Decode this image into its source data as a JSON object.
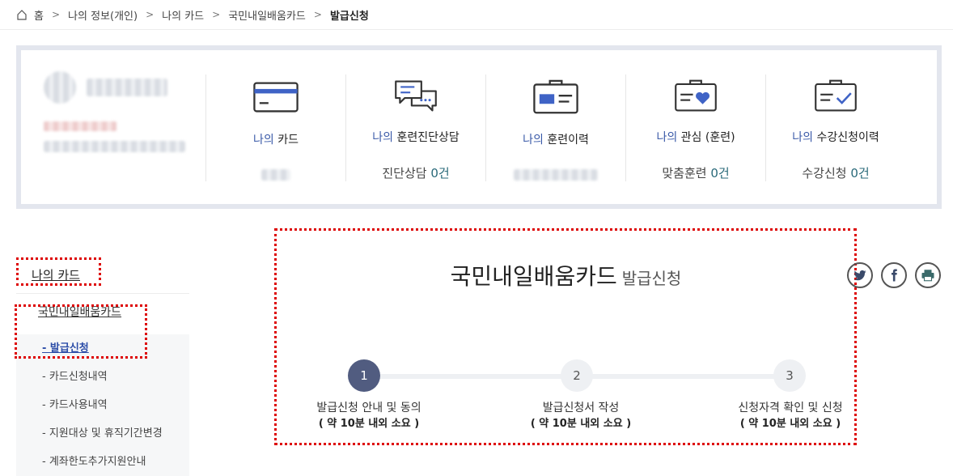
{
  "breadcrumb": {
    "items": [
      "홈",
      "나의 정보(개인)",
      "나의 카드",
      "국민내일배움카드",
      "발급신청"
    ]
  },
  "dashboard": {
    "stats": [
      {
        "prefix": "나의",
        "label": " 카드",
        "value_text": "",
        "value_num": "",
        "icon": "card-icon"
      },
      {
        "prefix": "나의",
        "label": " 훈련진단상담",
        "value_text": "진단상담 ",
        "value_num": "0건",
        "icon": "chat-icon"
      },
      {
        "prefix": "나의",
        "label": " 훈련이력",
        "value_text": "",
        "value_num": "",
        "icon": "id-card-icon"
      },
      {
        "prefix": "나의",
        "label": " 관심 (훈련)",
        "value_text": "맞춤훈련 ",
        "value_num": "0건",
        "icon": "heart-card-icon"
      },
      {
        "prefix": "나의",
        "label": " 수강신청이력",
        "value_text": "수강신청 ",
        "value_num": "0건",
        "icon": "check-card-icon"
      }
    ]
  },
  "sidebar": {
    "title": "나의 카드",
    "sub": "국민내일배움카드",
    "items": [
      "- 발급신청",
      "- 카드신청내역",
      "- 카드사용내역",
      "- 지원대상 및 휴직기간변경",
      "- 계좌한도추가지원안내"
    ]
  },
  "main": {
    "title": "국민내일배움카드",
    "subtitle": "발급신청"
  },
  "share": [
    "twitter-icon",
    "facebook-icon",
    "print-icon"
  ],
  "steps": [
    {
      "num": "1",
      "label": "발급신청 안내 및 동의",
      "time": "( 약 10분 내외 소요 )",
      "active": true
    },
    {
      "num": "2",
      "label": "발급신청서 작성",
      "time": "( 약 10분 내외 소요 )",
      "active": false
    },
    {
      "num": "3",
      "label": "신청자격 확인 및 신청",
      "time": "( 약 10분 내외 소요 )",
      "active": false
    }
  ],
  "colors": {
    "accent": "#3a5aa8",
    "step_active": "#515c80",
    "highlight": "#dd0000"
  }
}
